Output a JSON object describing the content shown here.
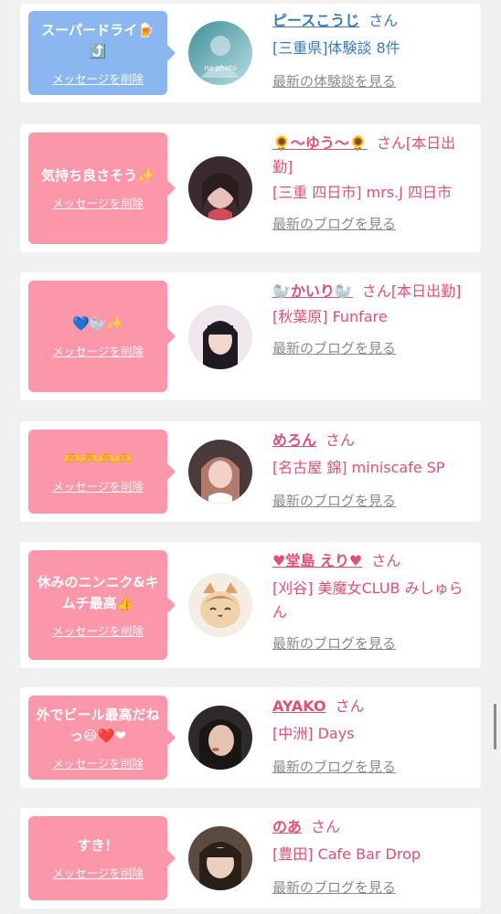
{
  "theme": {
    "pink": "#fc97a9",
    "blue": "#8ab7ef",
    "name_pink": "#e24f74",
    "name_blue": "#3a79b6",
    "link_gray": "#8a8a8a"
  },
  "items": [
    {
      "message": "スーパードライ🍺⤴️",
      "delete_label": "メッセージを削除",
      "name": "ピースこうじ",
      "honorific": "さん",
      "status": "",
      "shop": "[三重県]体験談 8件",
      "latest_link": "最新の体験談を見る",
      "avatar_text": "no photo",
      "color": "blue"
    },
    {
      "message": "気持ち良さそう✨",
      "delete_label": "メッセージを削除",
      "name": "🌻〜ゆう〜🌻",
      "honorific": "さん",
      "status": "[本日出勤]",
      "shop": "[三重 四日市] mrs.J 四日市",
      "latest_link": "最新のブログを見る",
      "color": "pink"
    },
    {
      "message": "💙🦭✨",
      "delete_label": "メッセージを削除",
      "name": "🦭かいり🦭",
      "honorific": "さん",
      "status": "[本日出勤]",
      "shop": "[秋葉原] Funfare",
      "latest_link": "最新のブログを見る",
      "color": "pink"
    },
    {
      "message": "🫶🫶🫶🫶",
      "delete_label": "メッセージを削除",
      "name": "めろん",
      "honorific": "さん",
      "status": "",
      "shop": "[名古屋 錦] miniscafe SP",
      "latest_link": "最新のブログを見る",
      "color": "pink"
    },
    {
      "message": "休みのニンニク&キムチ最高👍",
      "delete_label": "メッセージを削除",
      "name": "♥堂島 えり♥",
      "honorific": "さん",
      "status": "",
      "shop": "[刈谷] 美魔女CLUB みしゅらん",
      "latest_link": "最新のブログを見る",
      "color": "pink"
    },
    {
      "message": "外でビール最高だねっ😆❤️❤",
      "delete_label": "メッセージを削除",
      "name": "AYAKO",
      "honorific": "さん",
      "status": "",
      "shop": "[中洲] Days",
      "latest_link": "最新のブログを見る",
      "color": "pink"
    },
    {
      "message": "すき！",
      "delete_label": "メッセージを削除",
      "name": "のあ",
      "honorific": "さん",
      "status": "",
      "shop": "[豊田] Cafe Bar Drop",
      "latest_link": "最新のブログを見る",
      "color": "pink"
    }
  ]
}
